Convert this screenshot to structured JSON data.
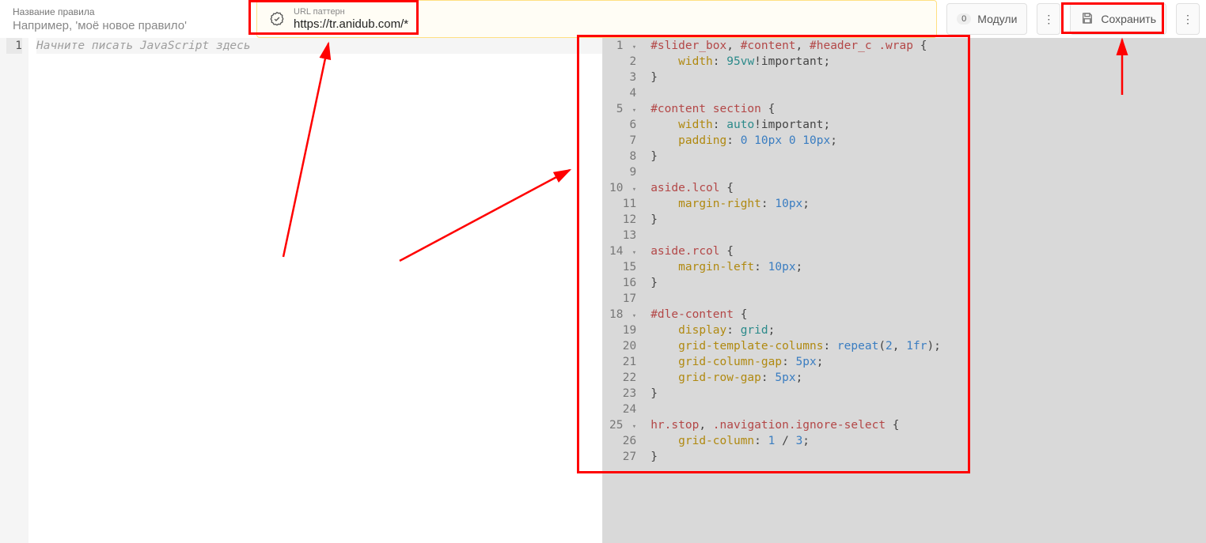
{
  "header": {
    "rule_label": "Название правила",
    "rule_placeholder": "Например, 'моё новое правило'",
    "url_label": "URL паттерн",
    "url_value": "https://tr.anidub.com/*",
    "modules_count": "0",
    "modules_label": "Модули",
    "save_label": "Сохранить"
  },
  "editor_left": {
    "placeholder": "Начните писать JavaScript здесь"
  },
  "editor_right": {
    "lines": [
      {
        "n": 1,
        "fold": true,
        "tokens": [
          [
            "sel",
            "#slider_box"
          ],
          [
            "punc",
            ", "
          ],
          [
            "sel",
            "#content"
          ],
          [
            "punc",
            ", "
          ],
          [
            "sel",
            "#header_c"
          ],
          [
            "punc",
            " "
          ],
          [
            "sel",
            ".wrap"
          ],
          [
            "punc",
            " {"
          ]
        ]
      },
      {
        "n": 2,
        "tokens": [
          [
            "punc",
            "    "
          ],
          [
            "prop",
            "width"
          ],
          [
            "punc",
            ": "
          ],
          [
            "val",
            "95vw"
          ],
          [
            "kw",
            "!important"
          ],
          [
            "punc",
            ";"
          ]
        ]
      },
      {
        "n": 3,
        "tokens": [
          [
            "punc",
            "}"
          ]
        ]
      },
      {
        "n": 4,
        "tokens": []
      },
      {
        "n": 5,
        "fold": true,
        "tokens": [
          [
            "sel",
            "#content"
          ],
          [
            "punc",
            " "
          ],
          [
            "sel",
            "section"
          ],
          [
            "punc",
            " {"
          ]
        ]
      },
      {
        "n": 6,
        "tokens": [
          [
            "punc",
            "    "
          ],
          [
            "prop",
            "width"
          ],
          [
            "punc",
            ": "
          ],
          [
            "val",
            "auto"
          ],
          [
            "kw",
            "!important"
          ],
          [
            "punc",
            ";"
          ]
        ]
      },
      {
        "n": 7,
        "tokens": [
          [
            "punc",
            "    "
          ],
          [
            "prop",
            "padding"
          ],
          [
            "punc",
            ": "
          ],
          [
            "num",
            "0"
          ],
          [
            "punc",
            " "
          ],
          [
            "num",
            "10px"
          ],
          [
            "punc",
            " "
          ],
          [
            "num",
            "0"
          ],
          [
            "punc",
            " "
          ],
          [
            "num",
            "10px"
          ],
          [
            "punc",
            ";"
          ]
        ]
      },
      {
        "n": 8,
        "tokens": [
          [
            "punc",
            "}"
          ]
        ]
      },
      {
        "n": 9,
        "tokens": []
      },
      {
        "n": 10,
        "fold": true,
        "tokens": [
          [
            "sel",
            "aside"
          ],
          [
            "sel",
            ".lcol"
          ],
          [
            "punc",
            " {"
          ]
        ]
      },
      {
        "n": 11,
        "tokens": [
          [
            "punc",
            "    "
          ],
          [
            "prop",
            "margin-right"
          ],
          [
            "punc",
            ": "
          ],
          [
            "num",
            "10px"
          ],
          [
            "punc",
            ";"
          ]
        ]
      },
      {
        "n": 12,
        "tokens": [
          [
            "punc",
            "}"
          ]
        ]
      },
      {
        "n": 13,
        "tokens": []
      },
      {
        "n": 14,
        "fold": true,
        "tokens": [
          [
            "sel",
            "aside"
          ],
          [
            "sel",
            ".rcol"
          ],
          [
            "punc",
            " {"
          ]
        ]
      },
      {
        "n": 15,
        "tokens": [
          [
            "punc",
            "    "
          ],
          [
            "prop",
            "margin-left"
          ],
          [
            "punc",
            ": "
          ],
          [
            "num",
            "10px"
          ],
          [
            "punc",
            ";"
          ]
        ]
      },
      {
        "n": 16,
        "tokens": [
          [
            "punc",
            "}"
          ]
        ]
      },
      {
        "n": 17,
        "tokens": []
      },
      {
        "n": 18,
        "fold": true,
        "tokens": [
          [
            "sel",
            "#dle-content"
          ],
          [
            "punc",
            " {"
          ]
        ]
      },
      {
        "n": 19,
        "tokens": [
          [
            "punc",
            "    "
          ],
          [
            "prop",
            "display"
          ],
          [
            "punc",
            ": "
          ],
          [
            "val",
            "grid"
          ],
          [
            "punc",
            ";"
          ]
        ]
      },
      {
        "n": 20,
        "tokens": [
          [
            "punc",
            "    "
          ],
          [
            "prop",
            "grid-template-columns"
          ],
          [
            "punc",
            ": "
          ],
          [
            "fn",
            "repeat"
          ],
          [
            "punc",
            "("
          ],
          [
            "num",
            "2"
          ],
          [
            "punc",
            ", "
          ],
          [
            "num",
            "1fr"
          ],
          [
            "punc",
            ");"
          ]
        ]
      },
      {
        "n": 21,
        "tokens": [
          [
            "punc",
            "    "
          ],
          [
            "prop",
            "grid-column-gap"
          ],
          [
            "punc",
            ": "
          ],
          [
            "num",
            "5px"
          ],
          [
            "punc",
            ";"
          ]
        ]
      },
      {
        "n": 22,
        "tokens": [
          [
            "punc",
            "    "
          ],
          [
            "prop",
            "grid-row-gap"
          ],
          [
            "punc",
            ": "
          ],
          [
            "num",
            "5px"
          ],
          [
            "punc",
            ";"
          ]
        ]
      },
      {
        "n": 23,
        "tokens": [
          [
            "punc",
            "}"
          ]
        ]
      },
      {
        "n": 24,
        "tokens": []
      },
      {
        "n": 25,
        "fold": true,
        "tokens": [
          [
            "sel",
            "hr"
          ],
          [
            "sel",
            ".stop"
          ],
          [
            "punc",
            ", "
          ],
          [
            "sel",
            ".navigation"
          ],
          [
            "sel",
            ".ignore-select"
          ],
          [
            "punc",
            " {"
          ]
        ]
      },
      {
        "n": 26,
        "tokens": [
          [
            "punc",
            "    "
          ],
          [
            "prop",
            "grid-column"
          ],
          [
            "punc",
            ": "
          ],
          [
            "num",
            "1"
          ],
          [
            "punc",
            " / "
          ],
          [
            "num",
            "3"
          ],
          [
            "punc",
            ";"
          ]
        ]
      },
      {
        "n": 27,
        "tokens": [
          [
            "punc",
            "}"
          ]
        ]
      }
    ]
  }
}
